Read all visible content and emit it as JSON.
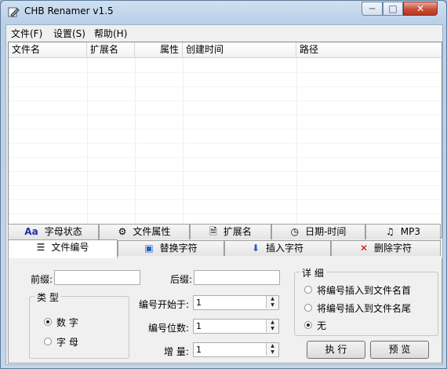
{
  "window": {
    "title": "CHB Renamer v1.5",
    "min": "─",
    "max": "□",
    "close": "✕"
  },
  "menu": [
    "文件(F)",
    "设置(S)",
    "帮助(H)"
  ],
  "list": {
    "columns": [
      "文件名",
      "扩展名",
      "属性",
      "创建时间",
      "路径"
    ],
    "rows": []
  },
  "tabs_row1": [
    {
      "label": "字母状态",
      "icon": "Aa"
    },
    {
      "label": "文件属性",
      "icon": "⚙"
    },
    {
      "label": "扩展名",
      "icon": "🗎"
    },
    {
      "label": "日期-时间",
      "icon": "◷"
    },
    {
      "label": "MP3",
      "icon": "♫"
    }
  ],
  "tabs_row2": [
    {
      "label": "文件编号",
      "icon": "☰"
    },
    {
      "label": "替换字符",
      "icon": "▣"
    },
    {
      "label": "插入字符",
      "icon": "⬇"
    },
    {
      "label": "删除字符",
      "icon": "✕"
    }
  ],
  "panel": {
    "prefix_label": "前缀:",
    "prefix_value": "",
    "suffix_label": "后缀:",
    "suffix_value": "",
    "type_group": "类 型",
    "type_options": [
      "数 字",
      "字 母"
    ],
    "type_selected": 0,
    "start_label": "编号开始于:",
    "start_value": "1",
    "digits_label": "编号位数:",
    "digits_value": "1",
    "increment_label": "增 量:",
    "increment_value": "1",
    "detail_group": "详 细",
    "detail_options": [
      "将编号插入到文件名首",
      "将编号插入到文件名尾",
      "无"
    ],
    "detail_selected": 2,
    "execute": "执 行",
    "preview": "预 览"
  },
  "colors": {
    "close_button": "#c74d38",
    "delete_icon": "#cc0000",
    "insert_icon": "#2a5db8"
  }
}
